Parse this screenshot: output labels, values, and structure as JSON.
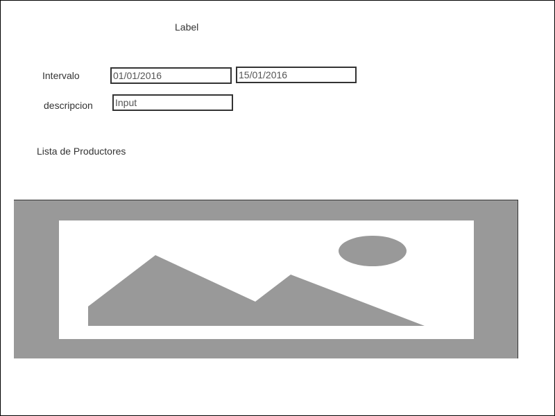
{
  "header": {
    "label": "Label"
  },
  "form": {
    "interval_label": "Intervalo",
    "interval_start": "01/01/2016",
    "interval_end": "15/01/2016",
    "description_label": "descripcion",
    "description_placeholder": "Input"
  },
  "producers": {
    "list_label": "Lista de Productores",
    "image_icon": "image-placeholder-icon"
  },
  "colors": {
    "field_border": "#333333",
    "placeholder_gray": "#999999",
    "text": "#333333"
  }
}
